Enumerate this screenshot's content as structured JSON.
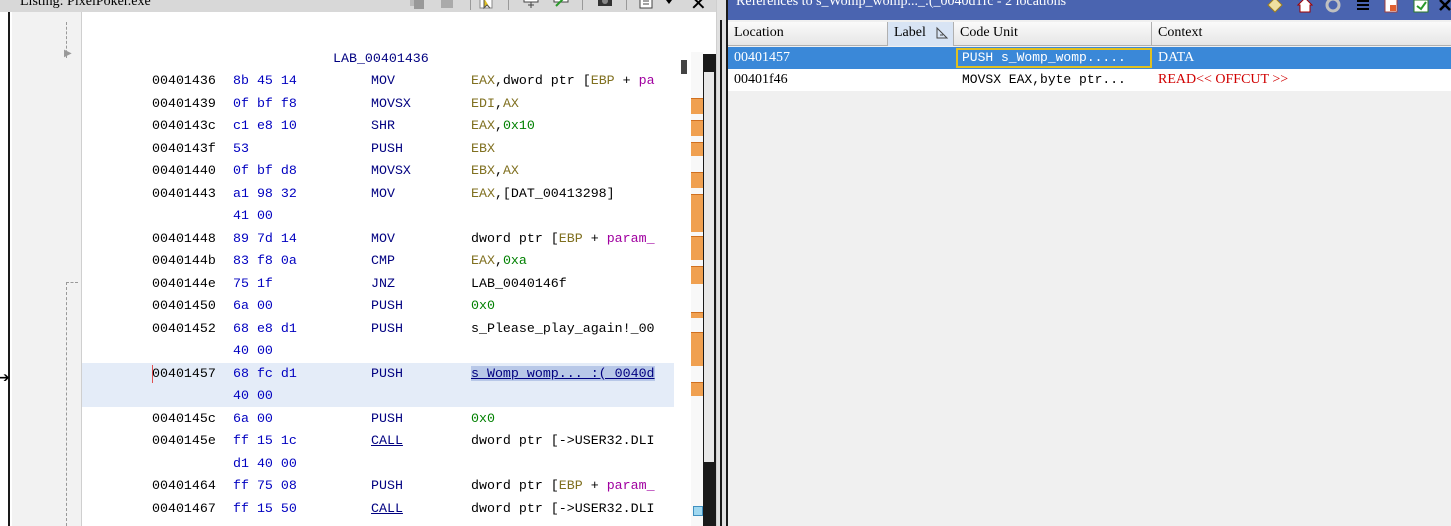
{
  "listing": {
    "title": "Listing: PixelPoker.exe",
    "close_label": "✕",
    "label_line": "LAB_00401436",
    "rows": [
      {
        "addr": "00401436",
        "bytes": "8b 45 14",
        "mnem": "MOV",
        "ops": [
          {
            "t": "EAX",
            "c": "op-reg"
          },
          {
            "t": ",dword ptr [",
            "c": "op-plain"
          },
          {
            "t": "EBP",
            "c": "op-reg"
          },
          {
            "t": " + ",
            "c": "op-plain"
          },
          {
            "t": "pa",
            "c": "op-param"
          }
        ]
      },
      {
        "addr": "00401439",
        "bytes": "0f bf f8",
        "mnem": "MOVSX",
        "ops": [
          {
            "t": "EDI",
            "c": "op-reg"
          },
          {
            "t": ",",
            "c": "op-plain"
          },
          {
            "t": "AX",
            "c": "op-reg"
          }
        ]
      },
      {
        "addr": "0040143c",
        "bytes": "c1 e8 10",
        "mnem": "SHR",
        "ops": [
          {
            "t": "EAX",
            "c": "op-reg"
          },
          {
            "t": ",",
            "c": "op-plain"
          },
          {
            "t": "0x10",
            "c": "op-num"
          }
        ]
      },
      {
        "addr": "0040143f",
        "bytes": "53",
        "mnem": "PUSH",
        "ops": [
          {
            "t": "EBX",
            "c": "op-reg"
          }
        ]
      },
      {
        "addr": "00401440",
        "bytes": "0f bf d8",
        "mnem": "MOVSX",
        "ops": [
          {
            "t": "EBX",
            "c": "op-reg"
          },
          {
            "t": ",",
            "c": "op-plain"
          },
          {
            "t": "AX",
            "c": "op-reg"
          }
        ]
      },
      {
        "addr": "00401443",
        "bytes": "a1 98 32",
        "mnem": "MOV",
        "ops": [
          {
            "t": "EAX",
            "c": "op-reg"
          },
          {
            "t": ",[DAT_00413298]",
            "c": "op-plain"
          }
        ]
      },
      {
        "addr": "",
        "bytes": "41 00",
        "mnem": "",
        "ops": []
      },
      {
        "addr": "00401448",
        "bytes": "89 7d 14",
        "mnem": "MOV",
        "ops": [
          {
            "t": "dword ptr [",
            "c": "op-plain"
          },
          {
            "t": "EBP",
            "c": "op-reg"
          },
          {
            "t": " + ",
            "c": "op-plain"
          },
          {
            "t": "param_",
            "c": "op-param"
          }
        ]
      },
      {
        "addr": "0040144b",
        "bytes": "83 f8 0a",
        "mnem": "CMP",
        "ops": [
          {
            "t": "EAX",
            "c": "op-reg"
          },
          {
            "t": ",",
            "c": "op-plain"
          },
          {
            "t": "0xa",
            "c": "op-num"
          }
        ]
      },
      {
        "addr": "0040144e",
        "bytes": "75 1f",
        "mnem": "JNZ",
        "ops": [
          {
            "t": "LAB_0040146f",
            "c": "op-plain"
          }
        ]
      },
      {
        "addr": "00401450",
        "bytes": "6a 00",
        "mnem": "PUSH",
        "ops": [
          {
            "t": "0x0",
            "c": "op-num"
          }
        ]
      },
      {
        "addr": "00401452",
        "bytes": "68 e8 d1",
        "mnem": "PUSH",
        "ops": [
          {
            "t": "s_Please_play_again!_00",
            "c": "op-plain"
          }
        ]
      },
      {
        "addr": "",
        "bytes": "40 00",
        "mnem": "",
        "ops": []
      },
      {
        "addr": "00401457",
        "bytes": "68 fc d1",
        "mnem": "PUSH",
        "ops": [
          {
            "t": "s_Womp_womp..._:(_0040d",
            "c": "op-sel"
          }
        ],
        "selected": true
      },
      {
        "addr": "",
        "bytes": "40 00",
        "mnem": "",
        "ops": [],
        "selected": true
      },
      {
        "addr": "0040145c",
        "bytes": "6a 00",
        "mnem": "PUSH",
        "ops": [
          {
            "t": "0x0",
            "c": "op-num"
          }
        ]
      },
      {
        "addr": "0040145e",
        "bytes": "ff 15 1c",
        "mnem": "CALL",
        "call": true,
        "ops": [
          {
            "t": "dword ptr [->USER32.DLI",
            "c": "op-plain"
          }
        ]
      },
      {
        "addr": "",
        "bytes": "d1 40 00",
        "mnem": "",
        "ops": []
      },
      {
        "addr": "00401464",
        "bytes": "ff 75 08",
        "mnem": "PUSH",
        "ops": [
          {
            "t": "dword ptr [",
            "c": "op-plain"
          },
          {
            "t": "EBP",
            "c": "op-reg"
          },
          {
            "t": " + ",
            "c": "op-plain"
          },
          {
            "t": "param_",
            "c": "op-param"
          }
        ]
      },
      {
        "addr": "00401467",
        "bytes": "ff 15 50",
        "mnem": "CALL",
        "call": true,
        "ops": [
          {
            "t": "dword ptr [->USER32.DLI",
            "c": "op-plain"
          }
        ]
      }
    ]
  },
  "references": {
    "title": "References to s_Womp_womp..._:(_0040d1fc - 2 locations",
    "columns": {
      "location": "Location",
      "label": "Label",
      "code_unit": "Code Unit",
      "context": "Context"
    },
    "rows": [
      {
        "location": "00401457",
        "label": "",
        "code_unit": "PUSH s_Womp_womp.....",
        "context": "DATA",
        "selected": true
      },
      {
        "location": "00401f46",
        "label": "",
        "code_unit": "MOVSX EAX,byte ptr...",
        "context": "READ<< OFFCUT >>",
        "selected": false
      }
    ]
  },
  "colors": {
    "selection_blue": "#3a88d8",
    "title_bar_blue": "#4a64b0",
    "read_red": "#d00000",
    "register_olive": "#807020",
    "number_green": "#008000",
    "param_purple": "#a000a0",
    "bytes_blue": "#0000c0"
  }
}
